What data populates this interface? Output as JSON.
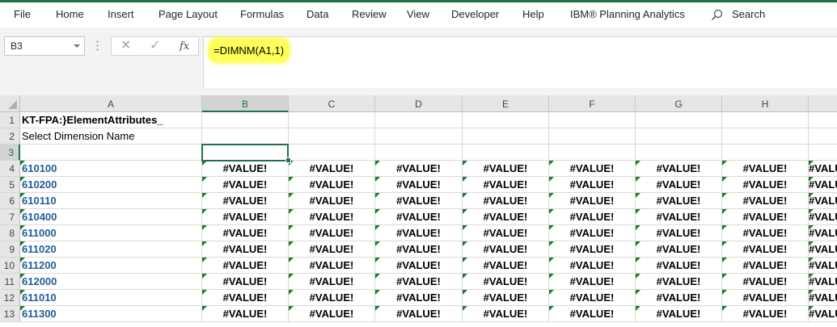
{
  "menu": {
    "items": [
      "File",
      "Home",
      "Insert",
      "Page Layout",
      "Formulas",
      "Data",
      "Review",
      "View",
      "Developer",
      "Help",
      "IBM® Planning Analytics"
    ],
    "search_label": "Search"
  },
  "formula_bar": {
    "name_box": "B3",
    "cancel_glyph": "✕",
    "enter_glyph": "✓",
    "fx_label": "fx",
    "formula": "=DIMNM(A1,1)",
    "highlight_color": "#ffff5a"
  },
  "sheet": {
    "columns": [
      "A",
      "B",
      "C",
      "D",
      "E",
      "F",
      "G",
      "H"
    ],
    "selected_column": "B",
    "selected_row": 3,
    "rows": [
      {
        "num": "1",
        "a": "KT-FPA:}ElementAttributes_"
      },
      {
        "num": "2",
        "a": "Select Dimension Name"
      },
      {
        "num": "3",
        "a": ""
      },
      {
        "num": "4",
        "a": "610100"
      },
      {
        "num": "5",
        "a": "610200"
      },
      {
        "num": "6",
        "a": "610110"
      },
      {
        "num": "7",
        "a": "610400"
      },
      {
        "num": "8",
        "a": "611000"
      },
      {
        "num": "9",
        "a": "611020"
      },
      {
        "num": "10",
        "a": "611200"
      },
      {
        "num": "11",
        "a": "612000"
      },
      {
        "num": "12",
        "a": "611010"
      },
      {
        "num": "13",
        "a": "611300"
      }
    ],
    "error_value": "#VALUE!",
    "accent_color": "#217346",
    "code_color": "#1f5c99"
  }
}
